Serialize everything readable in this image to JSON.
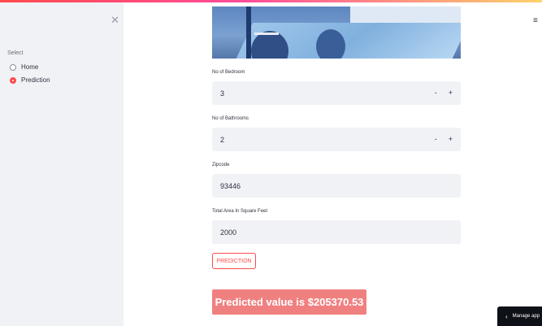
{
  "sidebar": {
    "close_icon": "x-icon",
    "select_label": "Select",
    "options": [
      {
        "label": "Home",
        "selected": false
      },
      {
        "label": "Prediction",
        "selected": true
      }
    ]
  },
  "header": {
    "menu_icon": "hamburger-icon",
    "menu_glyph": "≡"
  },
  "hero": {
    "icon": "kitchen-photo"
  },
  "form": {
    "bedrooms": {
      "label": "No of Bedroom",
      "value": "3",
      "minus": "-",
      "plus": "+"
    },
    "bathrooms": {
      "label": "No of Bathrooms",
      "value": "2",
      "minus": "-",
      "plus": "+"
    },
    "zipcode": {
      "label": "Zipcode",
      "value": "93446"
    },
    "area": {
      "label": "Total Area In Square Feet",
      "value": "2000"
    }
  },
  "button": {
    "label": "PREDICTION"
  },
  "result": {
    "text": "Predicted value is $205370.53"
  },
  "manage": {
    "label": "Manage app",
    "chevron": "‹"
  },
  "colors": {
    "accent": "#ff4b4b",
    "result_bg": "#f08080",
    "sidebar_bg": "#f0f2f6"
  }
}
